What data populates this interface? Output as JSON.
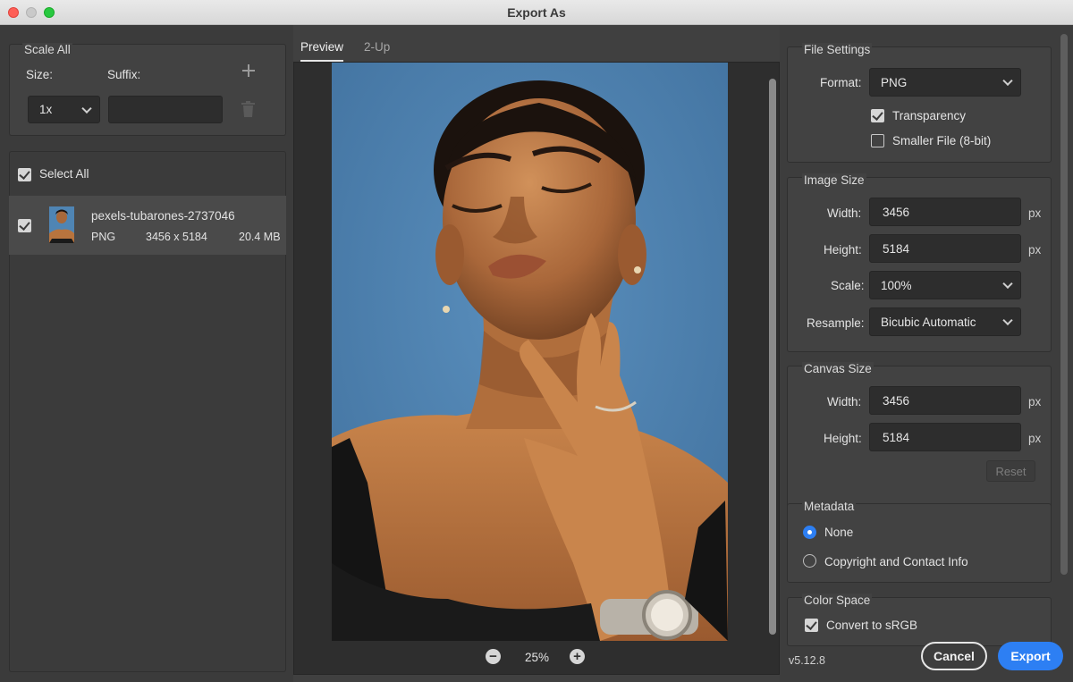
{
  "window": {
    "title": "Export As"
  },
  "scale_all": {
    "header": "Scale All",
    "size_label": "Size:",
    "suffix_label": "Suffix:",
    "size_value": "1x",
    "suffix_value": "",
    "add_icon": "plus-icon",
    "delete_icon": "trash-icon"
  },
  "assets": {
    "select_all_label": "Select All",
    "select_all_checked": true,
    "items": [
      {
        "name": "pexels-tubarones-2737046",
        "format": "PNG",
        "dimensions": "3456 x 5184",
        "size": "20.4 MB",
        "checked": true
      }
    ]
  },
  "preview": {
    "tabs": [
      {
        "label": "Preview",
        "active": true
      },
      {
        "label": "2-Up",
        "active": false
      }
    ],
    "zoom": "25%"
  },
  "file_settings": {
    "header": "File Settings",
    "format_label": "Format:",
    "format_value": "PNG",
    "transparency_label": "Transparency",
    "transparency_checked": true,
    "smaller_file_label": "Smaller File (8-bit)",
    "smaller_file_checked": false
  },
  "image_size": {
    "header": "Image Size",
    "width_label": "Width:",
    "width_value": "3456",
    "height_label": "Height:",
    "height_value": "5184",
    "unit": "px",
    "scale_label": "Scale:",
    "scale_value": "100%",
    "resample_label": "Resample:",
    "resample_value": "Bicubic Automatic"
  },
  "canvas_size": {
    "header": "Canvas Size",
    "width_label": "Width:",
    "width_value": "3456",
    "height_label": "Height:",
    "height_value": "5184",
    "unit": "px",
    "reset_label": "Reset"
  },
  "metadata": {
    "header": "Metadata",
    "options": [
      {
        "label": "None",
        "selected": true
      },
      {
        "label": "Copyright and Contact Info",
        "selected": false
      }
    ]
  },
  "color_space": {
    "header": "Color Space",
    "convert_label": "Convert to sRGB",
    "convert_checked": true
  },
  "footer": {
    "version": "v5.12.8",
    "cancel_label": "Cancel",
    "export_label": "Export",
    "accent": "#2d7ff3"
  }
}
